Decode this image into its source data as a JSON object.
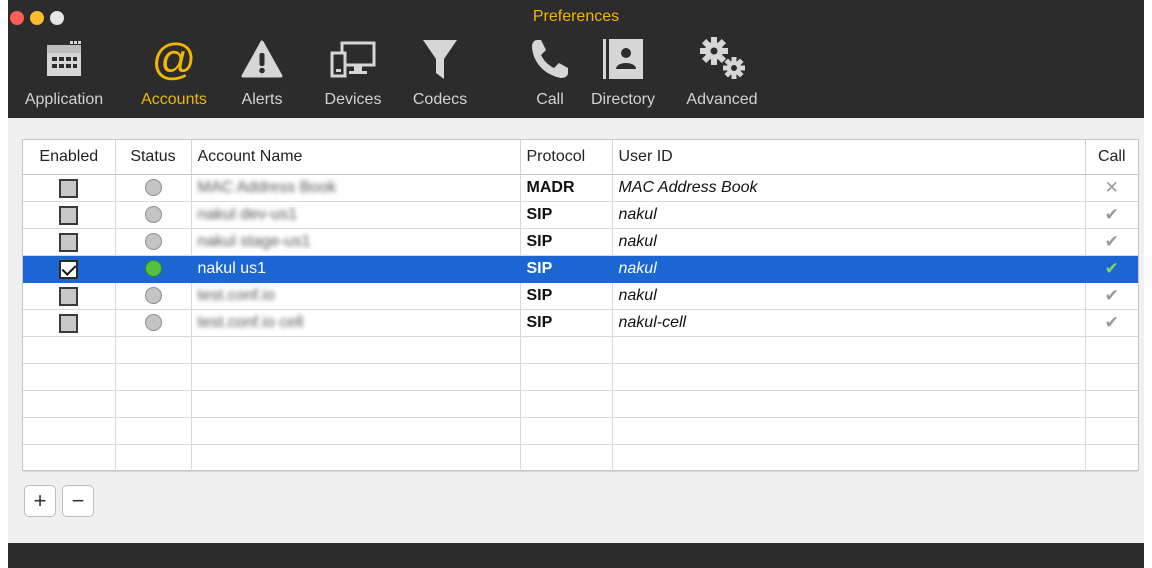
{
  "window": {
    "title": "Preferences"
  },
  "toolbar": [
    {
      "label": "Application",
      "icon": "calendar-icon"
    },
    {
      "label": "Accounts",
      "icon": "at-icon",
      "active": true
    },
    {
      "label": "Alerts",
      "icon": "alert-icon"
    },
    {
      "label": "Devices",
      "icon": "devices-icon"
    },
    {
      "label": "Codecs",
      "icon": "filter-icon"
    },
    {
      "label": "Call",
      "icon": "phone-icon"
    },
    {
      "label": "Directory",
      "icon": "contact-card-icon"
    },
    {
      "label": "Advanced",
      "icon": "gears-icon"
    }
  ],
  "table": {
    "headers": {
      "enabled": "Enabled",
      "status": "Status",
      "account_name": "Account Name",
      "protocol": "Protocol",
      "user_id": "User ID",
      "call": "Call"
    },
    "rows": [
      {
        "enabled": false,
        "online": false,
        "account_name": "MAC Address Book",
        "blurred": true,
        "protocol": "MADR",
        "user_id": "MAC Address Book",
        "call": "✕"
      },
      {
        "enabled": false,
        "online": false,
        "account_name": "nakul dev-us1",
        "blurred": true,
        "protocol": "SIP",
        "user_id": "nakul",
        "call": "✔"
      },
      {
        "enabled": false,
        "online": false,
        "account_name": "nakul stage-us1",
        "blurred": true,
        "protocol": "SIP",
        "user_id": "nakul",
        "call": "✔"
      },
      {
        "enabled": true,
        "online": true,
        "account_name": "nakul us1",
        "blurred": false,
        "protocol": "SIP",
        "user_id": "nakul",
        "call": "✔",
        "selected": true
      },
      {
        "enabled": false,
        "online": false,
        "account_name": "test.conf.io",
        "blurred": true,
        "protocol": "SIP",
        "user_id": "nakul",
        "call": "✔"
      },
      {
        "enabled": false,
        "online": false,
        "account_name": "test.conf.io cell",
        "blurred": true,
        "protocol": "SIP",
        "user_id": "nakul-cell",
        "call": "✔"
      }
    ],
    "empty_rows": 5
  },
  "buttons": {
    "add": "+",
    "remove": "−"
  },
  "colors": {
    "accent": "#f2b705",
    "selection": "#1b66d3",
    "online": "#53c240",
    "titlebar": "#2c2c2c"
  }
}
